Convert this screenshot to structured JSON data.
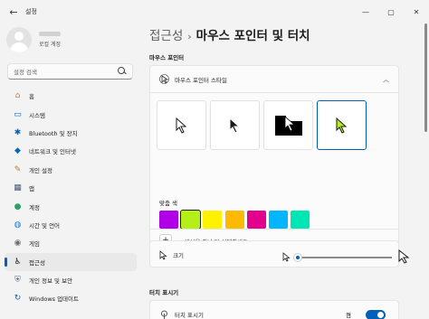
{
  "window": {
    "title": "설정",
    "back_icon": "arrow-left-icon",
    "minimize": "—",
    "maximize": "▢",
    "close": "✕"
  },
  "profile": {
    "subtitle": "로컬 계정"
  },
  "search": {
    "placeholder": "설정 검색"
  },
  "sidebar": {
    "items": [
      {
        "label": "홈",
        "icon": "home-icon",
        "glyph": "⌂",
        "color": "#d27d2d"
      },
      {
        "label": "시스템",
        "icon": "monitor-icon",
        "glyph": "▭",
        "color": "#0067c0"
      },
      {
        "label": "Bluetooth 및 장치",
        "icon": "bluetooth-icon",
        "glyph": "✱",
        "color": "#0067c0"
      },
      {
        "label": "네트워크 및 인터넷",
        "icon": "wifi-icon",
        "glyph": "◆",
        "color": "#0067c0"
      },
      {
        "label": "개인 설정",
        "icon": "brush-icon",
        "glyph": "✎",
        "color": "#c4722b"
      },
      {
        "label": "앱",
        "icon": "apps-icon",
        "glyph": "▦",
        "color": "#4a5a6a"
      },
      {
        "label": "계정",
        "icon": "account-icon",
        "glyph": "●",
        "color": "#2aa36b"
      },
      {
        "label": "시간 및 언어",
        "icon": "globe-icon",
        "glyph": "◍",
        "color": "#1a7fd0"
      },
      {
        "label": "게임",
        "icon": "gamepad-icon",
        "glyph": "◉",
        "color": "#6b6b6b"
      },
      {
        "label": "접근성",
        "icon": "accessibility-icon",
        "glyph": "♿",
        "color": "#1a1a1a",
        "active": true
      },
      {
        "label": "개인 정보 및 보안",
        "icon": "shield-icon",
        "glyph": "⛨",
        "color": "#5b6b7b"
      },
      {
        "label": "Windows 업데이트",
        "icon": "update-icon",
        "glyph": "↻",
        "color": "#0067c0"
      }
    ]
  },
  "breadcrumb": {
    "parent": "접근성",
    "separator": "›",
    "current": "마우스 포인터 및 터치"
  },
  "mouse_section": {
    "label": "마우스 포인터",
    "style_card": {
      "title": "마우스 포인터 스타일",
      "icon": "pointer-style-icon"
    },
    "styles": [
      "white",
      "black",
      "inverted",
      "custom"
    ],
    "selected_style": "custom",
    "color_label": "맞춤 색",
    "swatches": [
      "#b100e8",
      "#b5ef17",
      "#fff200",
      "#ffb900",
      "#e3008c",
      "#00b7ff",
      "#00e5b4"
    ],
    "selected_swatch": 1,
    "custom_color_label": "색상을 하나 더 선택하세요.",
    "size_label": "크기",
    "size_value": 0.0
  },
  "touch_section": {
    "label": "터치 표시기",
    "toggle_title": "터치 표시기",
    "toggle_state": "켬",
    "toggle_on": true
  },
  "colors": {
    "accent": "#005fb8",
    "lime_cursor": "#b5ef17"
  }
}
